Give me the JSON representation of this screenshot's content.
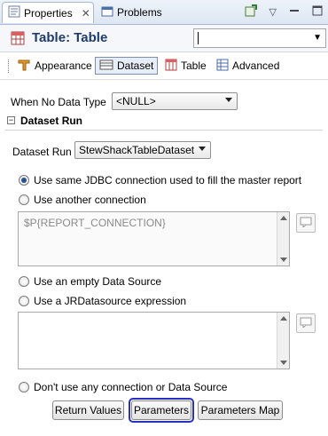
{
  "tabs": [
    {
      "label": "Properties",
      "icon": "properties-icon",
      "active": true
    },
    {
      "label": "Problems",
      "icon": "problems-icon",
      "active": false
    }
  ],
  "title": "Table: Table",
  "title_input_value": "",
  "section_tabs": [
    {
      "label": "Appearance",
      "icon": "appearance-icon",
      "selected": false
    },
    {
      "label": "Dataset",
      "icon": "dataset-icon",
      "selected": true
    },
    {
      "label": "Table",
      "icon": "table-icon",
      "selected": false
    },
    {
      "label": "Advanced",
      "icon": "advanced-icon",
      "selected": false
    }
  ],
  "when_no_data": {
    "label": "When No Data Type",
    "value": "<NULL>"
  },
  "dataset_run": {
    "header": "Dataset Run",
    "label": "Dataset Run",
    "value": "StewShackTableDataset"
  },
  "options": {
    "same_jdbc": "Use same JDBC connection used to fill the master report",
    "another_connection": "Use another connection",
    "connection_expression": "$P{REPORT_CONNECTION}",
    "empty_source": "Use an empty Data Source",
    "jrdatasource": "Use a JRDatasource expression",
    "jrdatasource_expression": "",
    "no_connection": "Don't use any connection or Data Source"
  },
  "selected_option": "same_jdbc",
  "buttons": {
    "return_values": "Return Values",
    "parameters": "Parameters",
    "parameters_map": "Parameters Map"
  },
  "colors": {
    "title": "#1e3c6c",
    "focus": "#2832c2",
    "radio_dot": "#2b4f8c"
  }
}
